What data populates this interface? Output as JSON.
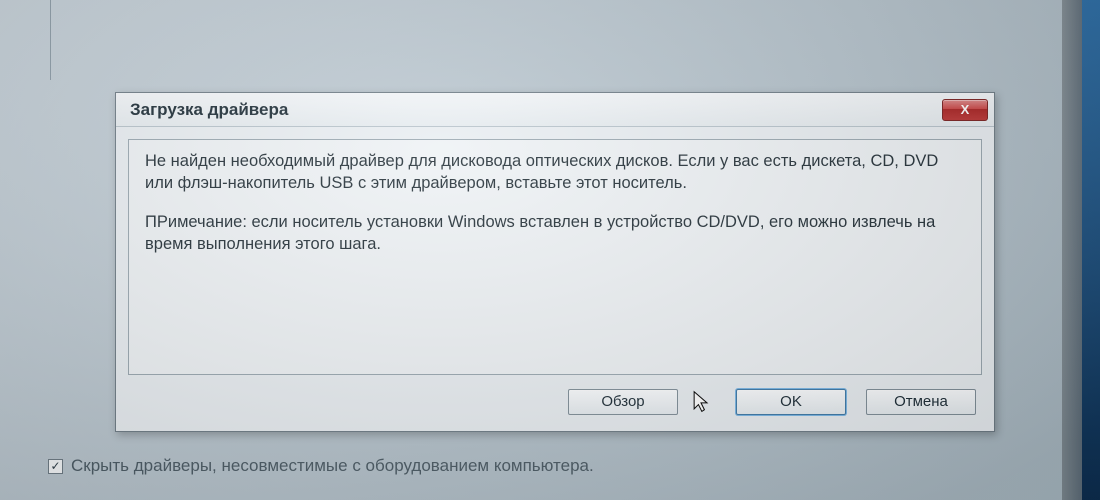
{
  "dialog": {
    "title": "Загрузка драйвера",
    "close_glyph": "X",
    "message1": "Не найден необходимый драйвер для дисковода оптических дисков. Если у вас есть дискета, CD, DVD или флэш-накопитель USB с этим драйвером, вставьте этот носитель.",
    "message2": "ПРимечание: если носитель установки Windows вставлен в устройство CD/DVD, его можно извлечь на время выполнения этого шага.",
    "buttons": {
      "browse": "Обзор",
      "ok": "OK",
      "cancel": "Отмена"
    }
  },
  "parent": {
    "hide_incompatible_label": "Скрыть драйверы, несовместимые с оборудованием компьютера.",
    "hide_incompatible_checked": true
  }
}
